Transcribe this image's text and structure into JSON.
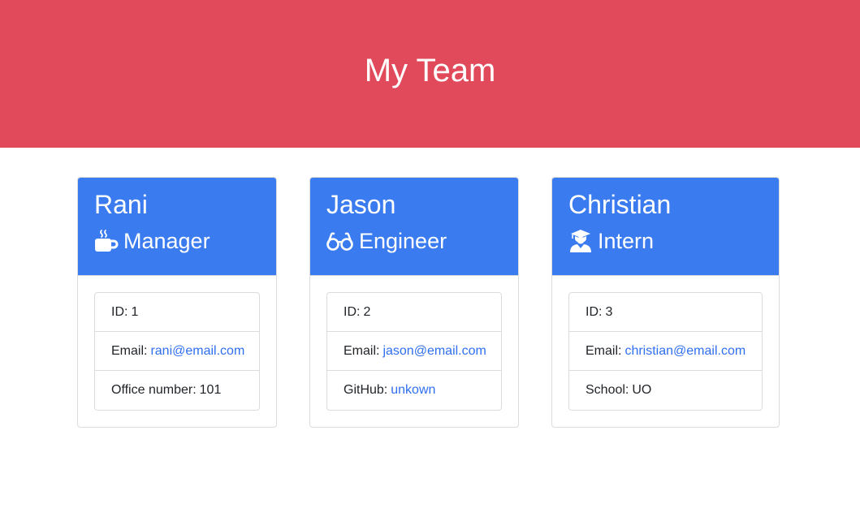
{
  "header": {
    "title": "My Team"
  },
  "colors": {
    "header_bg": "#e04a5a",
    "card_header_bg": "#3a7bf0",
    "link": "#2f6ff0"
  },
  "cards": [
    {
      "name": "Rani",
      "role": "Manager",
      "role_icon": "coffee-mug-icon",
      "id_label": "ID:",
      "id_value": "1",
      "email_label": "Email:",
      "email_value": "rani@email.com",
      "extra_label": "Office number:",
      "extra_value": "101"
    },
    {
      "name": "Jason",
      "role": "Engineer",
      "role_icon": "glasses-icon",
      "id_label": "ID:",
      "id_value": "2",
      "email_label": "Email:",
      "email_value": "jason@email.com",
      "extra_label": "GitHub:",
      "extra_value": "unkown"
    },
    {
      "name": "Christian",
      "role": "Intern",
      "role_icon": "graduate-icon",
      "id_label": "ID:",
      "id_value": "3",
      "email_label": "Email:",
      "email_value": "christian@email.com",
      "extra_label": "School:",
      "extra_value": "UO"
    }
  ]
}
